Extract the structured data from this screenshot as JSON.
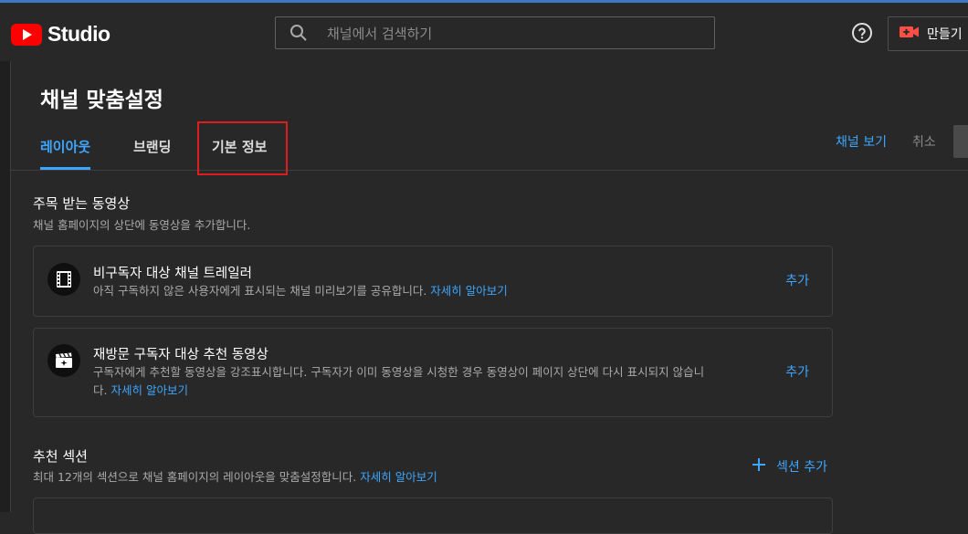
{
  "app": {
    "logo_text": "Studio"
  },
  "header": {
    "search_placeholder": "채널에서 검색하기",
    "create_label": "만들기"
  },
  "page": {
    "title": "채널 맞춤설정",
    "tabs": [
      {
        "label": "레이아웃",
        "active": true
      },
      {
        "label": "브랜딩",
        "active": false
      },
      {
        "label": "기본 정보",
        "active": false,
        "highlighted": true
      }
    ],
    "view_channel": "채널 보기",
    "cancel": "취소"
  },
  "featured": {
    "title": "주목 받는 동영상",
    "description": "채널 홈페이지의 상단에 동영상을 추가합니다.",
    "cards": [
      {
        "icon": "film-icon",
        "title": "비구독자 대상 채널 트레일러",
        "description": "아직 구독하지 않은 사용자에게 표시되는 채널 미리보기를 공유합니다.",
        "link": "자세히 알아보기",
        "action": "추가"
      },
      {
        "icon": "clapper-sparkle-icon",
        "title": "재방문 구독자 대상 추천 동영상",
        "description_line1": "구독자에게 추천할 동영상을 강조표시합니다. 구독자가 이미 동영상을 시청한 경우 동영상이 페이지 상단에 다시 표시되지 않습니",
        "description_line2": "다.",
        "link": "자세히 알아보기",
        "action": "추가"
      }
    ]
  },
  "sections": {
    "title": "추천 섹션",
    "description": "최대 12개의 섹션으로 채널 홈페이지의 레이아웃을 맞춤설정합니다.",
    "link": "자세히 알아보기",
    "add_label": "섹션 추가"
  },
  "colors": {
    "background": "#282828",
    "accent": "#3ea6ff",
    "highlight_box": "#e01d1d",
    "brand_red": "#ff0000"
  }
}
